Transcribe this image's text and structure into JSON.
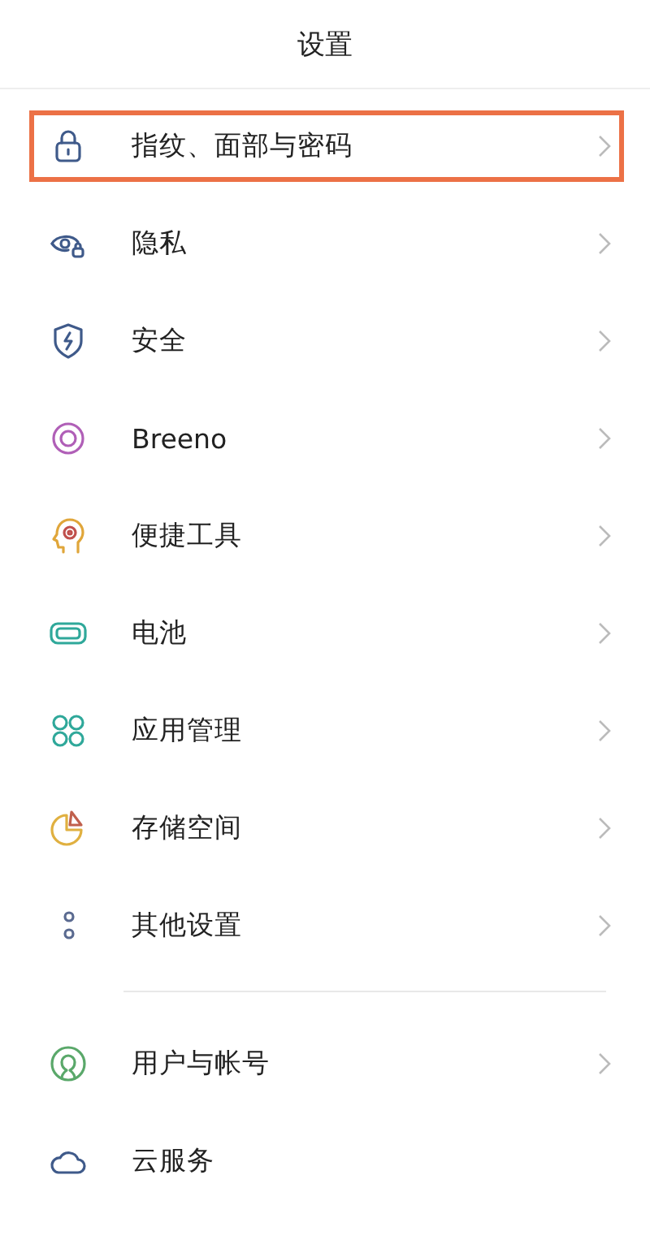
{
  "header": {
    "title": "设置"
  },
  "groups": [
    {
      "items": [
        {
          "label": "指纹、面部与密码",
          "kind": "lock",
          "highlighted": true,
          "chevron": true
        },
        {
          "label": "隐私",
          "kind": "eye-lock",
          "highlighted": false,
          "chevron": true
        },
        {
          "label": "安全",
          "kind": "shield",
          "highlighted": false,
          "chevron": true
        },
        {
          "label": "Breeno",
          "kind": "ring",
          "highlighted": false,
          "chevron": true
        },
        {
          "label": "便捷工具",
          "kind": "head",
          "highlighted": false,
          "chevron": true
        },
        {
          "label": "电池",
          "kind": "battery",
          "highlighted": false,
          "chevron": true
        },
        {
          "label": "应用管理",
          "kind": "grid",
          "highlighted": false,
          "chevron": true
        },
        {
          "label": "存储空间",
          "kind": "pie",
          "highlighted": false,
          "chevron": true
        },
        {
          "label": "其他设置",
          "kind": "dots",
          "highlighted": false,
          "chevron": true
        }
      ]
    },
    {
      "items": [
        {
          "label": "用户与帐号",
          "kind": "user",
          "highlighted": false,
          "chevron": true
        },
        {
          "label": "云服务",
          "kind": "cloud",
          "highlighted": false,
          "chevron": false
        }
      ]
    }
  ]
}
